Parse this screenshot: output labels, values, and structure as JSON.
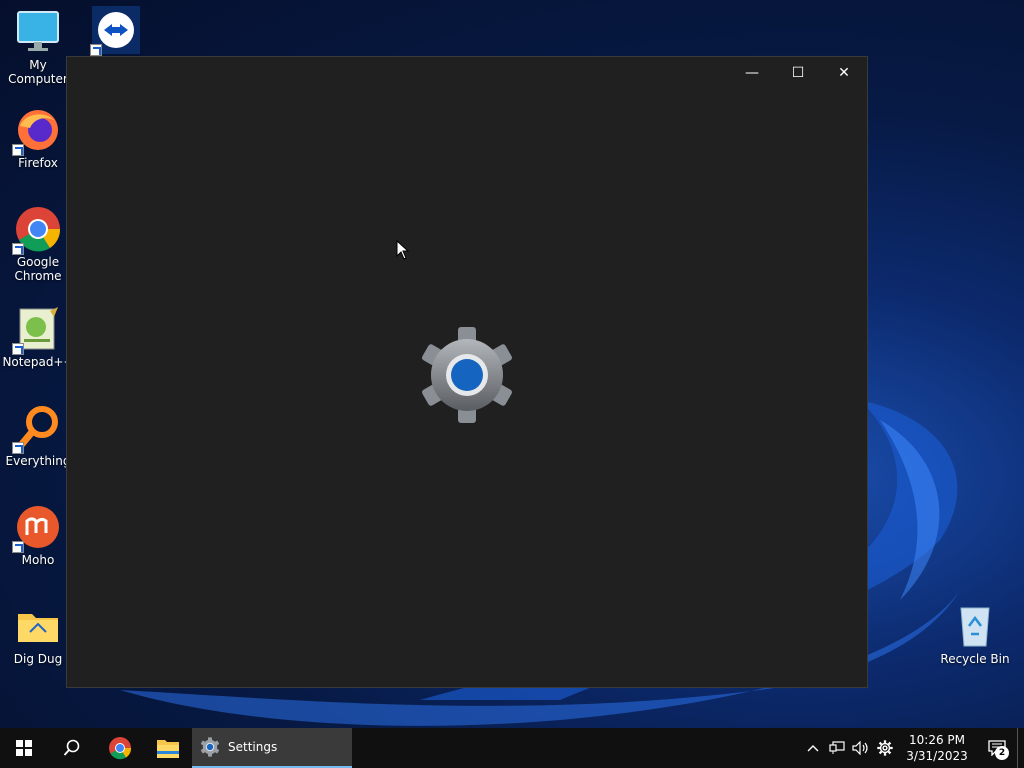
{
  "desktop": {
    "icons": [
      {
        "label": "My Computer"
      },
      {
        "label": ""
      },
      {
        "label": "Firefox"
      },
      {
        "label": "Google Chrome"
      },
      {
        "label": "Notepad++"
      },
      {
        "label": "Everything"
      },
      {
        "label": "Moho"
      },
      {
        "label": "Dig Dug"
      },
      {
        "label": "Recycle Bin"
      }
    ]
  },
  "window": {
    "minimize_symbol": "—",
    "maximize_symbol": "☐",
    "close_symbol": "✕"
  },
  "taskbar": {
    "active_app": {
      "label": "Settings"
    },
    "clock": {
      "time": "10:26 PM",
      "date": "3/31/2023"
    },
    "notification_count": "2"
  },
  "colors": {
    "window_bg": "#202020",
    "taskbar_bg": "#101010",
    "accent": "#76b9ed",
    "gear_center": "#1565c0"
  }
}
